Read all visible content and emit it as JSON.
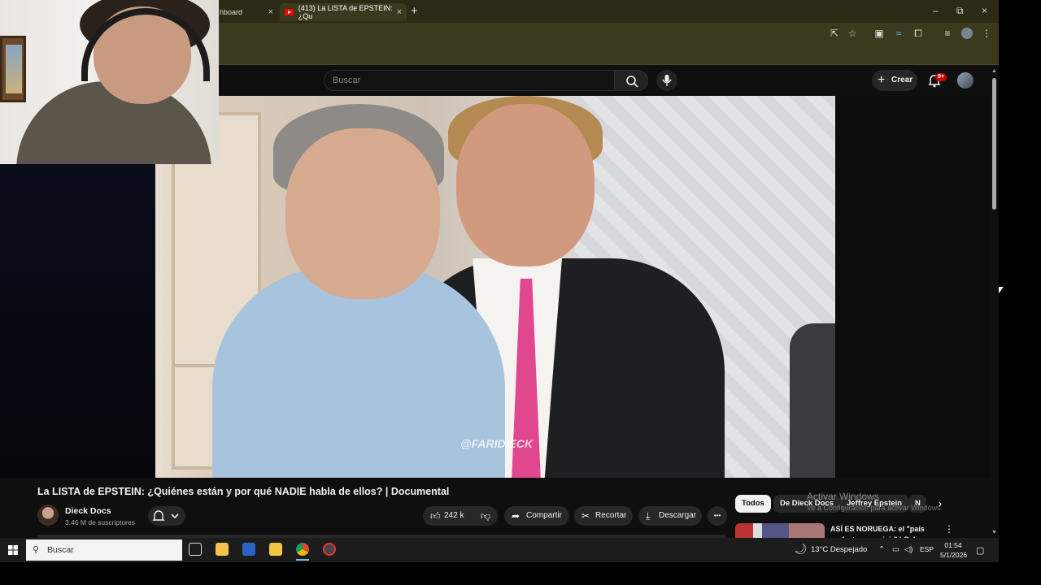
{
  "browser": {
    "tabs": [
      {
        "label": "hboard",
        "active": false
      },
      {
        "label": "(413) La LISTA de EPSTEIN: ¿Qu",
        "active": true
      }
    ],
    "new_tab_symbol": "+",
    "tab_close_symbol": "×",
    "window_controls": {
      "minimize": "–",
      "restore": "⧉",
      "close": "×"
    }
  },
  "youtube": {
    "search": {
      "placeholder": "Buscar"
    },
    "create_label": "Crear",
    "notifications_badge": "9+",
    "video": {
      "watermark": "@FARIDIECK",
      "title": "La LISTA de EPSTEIN: ¿Quiénes están y por qué NADIE habla de ellos? | Documental"
    },
    "channel": {
      "name": "Dieck Docs",
      "subscribers": "3.46 M de suscriptores"
    },
    "actions": {
      "likes": "242 k",
      "share": "Compartir",
      "clip": "Recortar",
      "download": "Descargar",
      "more": "•••"
    },
    "chips": [
      "Todos",
      "De Dieck Docs",
      "Jeffrey Epstein",
      "N"
    ],
    "recommendation": {
      "title": "ASÍ ES NORUEGA: el \"país perfecto para vivir\" | Oslo vo"
    }
  },
  "windows_activation": {
    "line1": "Activar Windows",
    "line2": "Ve a Configuración para activar Windows."
  },
  "taskbar": {
    "search_placeholder": "Buscar",
    "weather": "13°C  Despejado",
    "language": "ESP",
    "time": "01:54",
    "date": "5/1/2026"
  },
  "colors": {
    "youtube_red": "#ff0000",
    "chrome_frame": "#2b2a14",
    "page_bg": "#0f0f0f"
  }
}
